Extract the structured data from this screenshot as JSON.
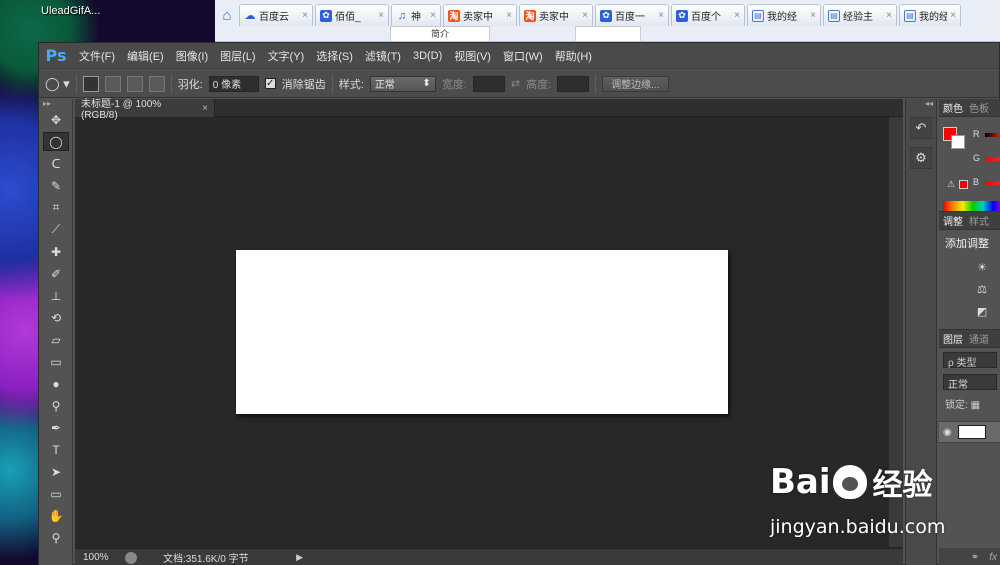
{
  "desktop": {
    "label": "UleadGifA..."
  },
  "browser": {
    "tabs": [
      {
        "icon": "cloud-icon",
        "label": "百度云",
        "x": "×"
      },
      {
        "icon": "baidu-paw-icon",
        "label": "佰佰_",
        "x": "×"
      },
      {
        "icon": "headphones-icon",
        "label": "神",
        "x": "×"
      },
      {
        "icon": "taobao-icon",
        "label": "卖家中",
        "x": "×"
      },
      {
        "icon": "taobao-icon",
        "label": "卖家中",
        "x": "×"
      },
      {
        "icon": "baidu-paw-icon",
        "label": "百度一",
        "x": "×"
      },
      {
        "icon": "baidu-paw-icon",
        "label": "百度个",
        "x": "×"
      },
      {
        "icon": "document-icon",
        "label": "我的经",
        "x": "×"
      },
      {
        "icon": "document-icon",
        "label": "经验主",
        "x": "×"
      },
      {
        "icon": "document-icon",
        "label": "我的经",
        "x": "×"
      }
    ],
    "page_snippet": "简介"
  },
  "ps": {
    "logo": "Ps",
    "menu": [
      "文件(F)",
      "编辑(E)",
      "图像(I)",
      "图层(L)",
      "文字(Y)",
      "选择(S)",
      "滤镜(T)",
      "3D(D)",
      "视图(V)",
      "窗口(W)",
      "帮助(H)"
    ],
    "options": {
      "feather_label": "羽化:",
      "feather_value": "0 像素",
      "antialias_label": "消除锯齿",
      "style_label": "样式:",
      "style_value": "正常",
      "width_label": "宽度:",
      "height_label": "高度:",
      "refine_button": "调整边缘..."
    },
    "document": {
      "tab_title": "未标题-1 @ 100%(RGB/8)",
      "tab_close": "×",
      "zoom": "100%",
      "doc_info": "文档:351.6K/0 字节"
    },
    "panels": {
      "color_tabs": [
        "颜色",
        "色板"
      ],
      "channels": [
        "R",
        "G",
        "B"
      ],
      "fg_color": "#ff0000",
      "bg_color": "#ffffff",
      "adjust_tabs": [
        "调整",
        "样式"
      ],
      "adjust_title": "添加调整",
      "layer_tabs": [
        "图层",
        "通道"
      ],
      "layer_filter": "ρ 类型",
      "blend_mode": "正常",
      "lock_label": "锁定:"
    }
  },
  "watermark": {
    "brand": "Bai",
    "brand_cn": "经验",
    "url": "jingyan.baidu.com"
  }
}
